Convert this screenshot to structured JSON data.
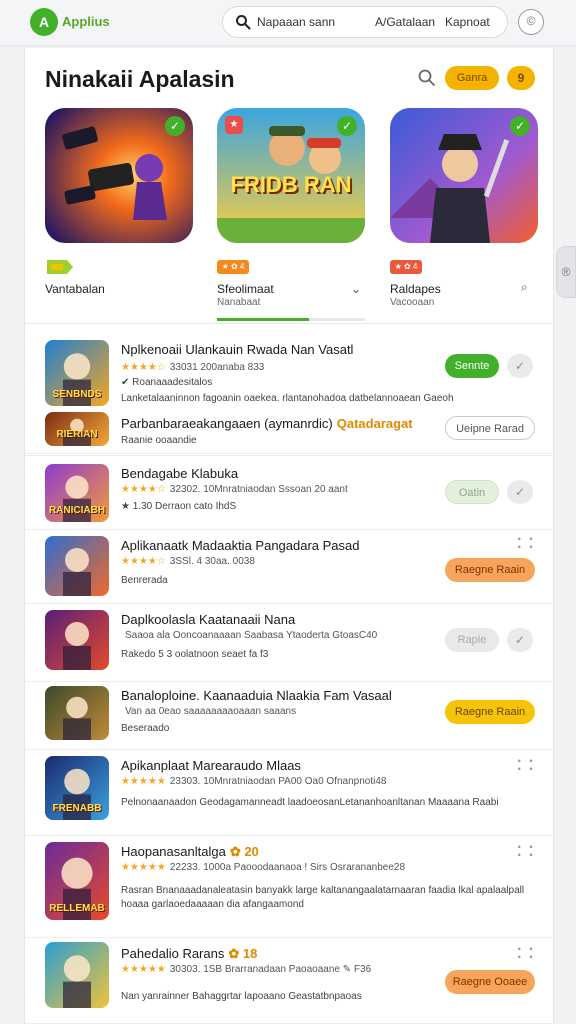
{
  "app": {
    "logo_glyph": "A",
    "logo_text": "Applius"
  },
  "search": {
    "query": "Napaaan sann",
    "link_1": "A/Gatalaan",
    "link_2": "Kapnoat"
  },
  "top_icon_glyph": "©",
  "featured": {
    "title": "Ninakaii Apalasin",
    "pill_label": "Ganra",
    "circle_label": "9",
    "cards": [
      {
        "label": "Vantabalan",
        "sub": "",
        "badge": "",
        "card_text": "",
        "colors": [
          "#2b1a5e",
          "#f26a1b"
        ]
      },
      {
        "label": "Sfeolimaat",
        "sub": "Nanabaat",
        "badge": "★ ✿ 4",
        "card_text": "FRIDB RAN",
        "colors": [
          "#3aa5e0",
          "#ffcf3a"
        ]
      },
      {
        "label": "Raldapes",
        "sub": "Vacooaan",
        "badge": "★ ✿ 4",
        "card_text": "",
        "colors": [
          "#3b5bd6",
          "#f25e2a"
        ]
      }
    ],
    "progress_fraction": 0.62
  },
  "items": [
    {
      "title": "Nplkenoaii Ulankauin Rwada Nan Vasatl",
      "tag": "",
      "stars": "★★★★☆",
      "meta": "33031 200anaba 833",
      "desc": "✔ Roanaaadesitalos",
      "desc_2": "Lanketalaaninnon fagoanin oaekea. rlantanohadoa datbelannoaean Gaeoh",
      "button": "Sennte",
      "button_style": "green",
      "check": "✓",
      "thumb_text": "SENBNDS",
      "thumb_colors": [
        "#1f7fd0",
        "#f6a623"
      ]
    },
    {
      "title": "Parbanbaraeakangaaen (aymanrdic)",
      "tag": "Qatadaragat",
      "stars": "",
      "meta": "",
      "desc": "Raanie ooaandie",
      "desc_2": "",
      "button": "Ueipne Rarad",
      "button_style": "outline",
      "check": "",
      "thumb_text": "RIERIAN",
      "thumb_colors": [
        "#7b2d12",
        "#f2a93b"
      ]
    },
    {
      "title": "Bendagabe Klabuka",
      "tag": "",
      "stars": "★★★★☆",
      "meta": "32302. 10Mnratniaodan Sssoan 20 aant",
      "desc": "★ 1.30 Derraon cato IhdS",
      "desc_2": "",
      "button": "Oatin",
      "button_style": "green-pale",
      "check": "✓",
      "thumb_text": "RANICIABH",
      "thumb_colors": [
        "#8e3bd0",
        "#f59a3a"
      ]
    },
    {
      "title": "Aplikanaatk Madaaktia Pangadara Pasad",
      "tag": "",
      "stars": "★★★★☆",
      "meta": "3SSl. 4 30aa. 0038",
      "desc": "Benrerada",
      "desc_2": "",
      "button": "Raegne Raain",
      "button_style": "orange",
      "check": "",
      "thumb_text": "",
      "thumb_colors": [
        "#2f6dd0",
        "#f06a2a"
      ]
    },
    {
      "title": "Daplkoolasla Kaatanaaii Nana",
      "tag": "",
      "stars": "",
      "meta": "Saaoa ala Ooncoanaaaan Saabasa Ytaoderta GtoasC40",
      "desc": "Rakedo 5 3 oolatnoon seaet fa f3",
      "desc_2": "",
      "button": "Raple",
      "button_style": "gray",
      "check": "✓",
      "thumb_text": "",
      "thumb_colors": [
        "#5a1f7a",
        "#e34a2a"
      ]
    },
    {
      "title": "Banaloploine. Kaanaaduia Nlaakia Fam Vasaal",
      "tag": "",
      "stars": "",
      "meta": "Van aa 0eao saaaaaaaaoaaan saaans",
      "desc": "Beseraado",
      "desc_2": "",
      "button": "Raegne Raain",
      "button_style": "yellow",
      "check": "",
      "thumb_text": "",
      "thumb_colors": [
        "#3b4a2a",
        "#c08a3a"
      ]
    },
    {
      "title": "Apikanplaat Marearaudo Mlaas",
      "tag": "",
      "stars": "★★★★★",
      "meta": "23303. 10Mnratniaodan PA00 Oa0 Ofnanpnoti48",
      "desc": "Pelnonaanaadon Geodagamanneadt laadoeosanLetananhoanltanan Maaaana Raabi",
      "desc_2": "",
      "button": "",
      "button_style": "",
      "check": "",
      "thumb_text": "FRENABB",
      "thumb_colors": [
        "#1b2a6e",
        "#3aa0e0"
      ]
    },
    {
      "title": "Haopanasanltalga",
      "tag": "✿ 20",
      "stars": "★★★★★",
      "meta": "22233. 1000a Paooodaanaoa ! Sirs Osrarananbee28",
      "desc": "Rasran Bnanaaadanaleatasin banyakk large kaltanangaalatarnaaran faadia lkal apalaalpall",
      "desc_2": "hoaaa garlaoedaaaaan dia afangaamond",
      "button": "",
      "button_style": "",
      "check": "",
      "thumb_text": "RELLEMAB",
      "thumb_colors": [
        "#6a2a9a",
        "#e84a2a"
      ]
    },
    {
      "title": "Pahedalio Rarans",
      "tag": "✿ 18",
      "stars": "★★★★★",
      "meta": "30303. 1SB Brarranadaan Paoaoaane ✎ F36",
      "desc": "Nan yanrainner Bahaggrtar lapoaano Geastatbnpaoas",
      "desc_2": "",
      "button": "Raegne Ooaee",
      "button_style": "orange",
      "check": "",
      "thumb_text": "",
      "thumb_colors": [
        "#2aa0d0",
        "#f2c23a"
      ]
    }
  ],
  "edge_handle_glyph": "®"
}
